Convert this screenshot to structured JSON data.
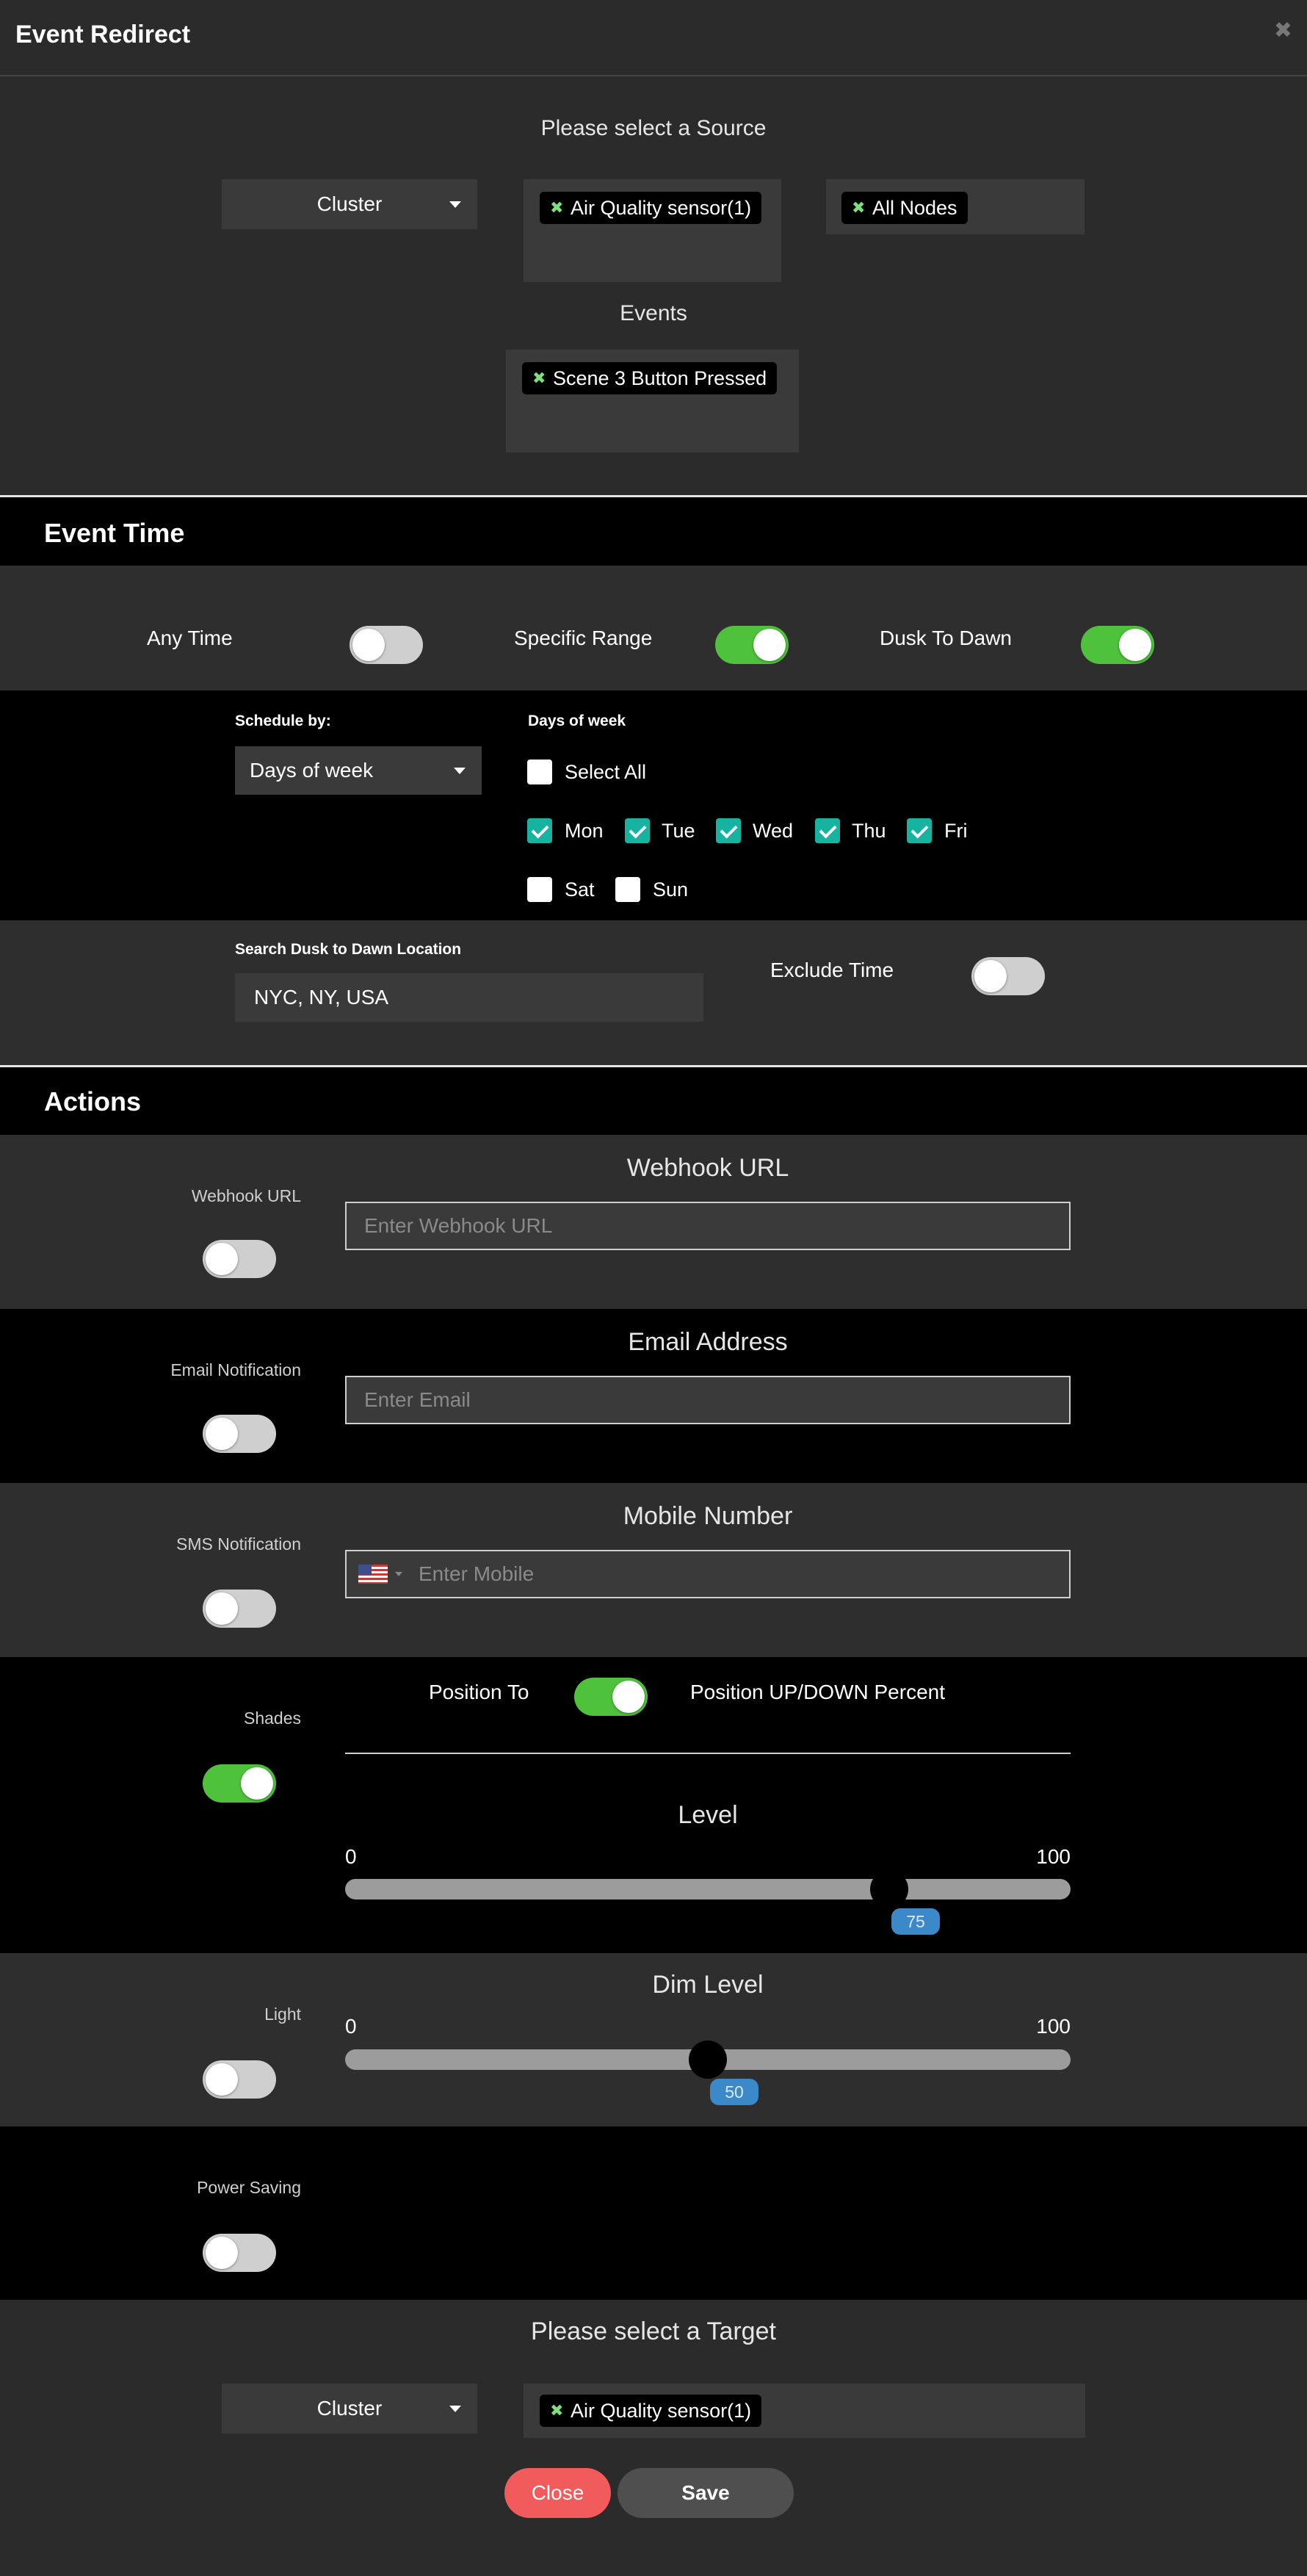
{
  "dialog": {
    "title": "Event Redirect",
    "close_icon": "close-icon"
  },
  "source": {
    "heading": "Please select a Source",
    "type_select": "Cluster",
    "selected_sources": [
      "Air Quality sensor(1)"
    ],
    "selected_nodes": [
      "All Nodes"
    ],
    "events_heading": "Events",
    "selected_events": [
      "Scene 3 Button Pressed"
    ]
  },
  "event_time": {
    "heading": "Event Time",
    "any_time": {
      "label": "Any Time",
      "on": false
    },
    "specific_range": {
      "label": "Specific Range",
      "on": true
    },
    "dusk_to_dawn": {
      "label": "Dusk To Dawn",
      "on": true
    },
    "schedule_by_label": "Schedule by:",
    "schedule_by_value": "Days of week",
    "days_label": "Days of week",
    "select_all_label": "Select All",
    "days": [
      {
        "label": "Mon",
        "checked": true
      },
      {
        "label": "Tue",
        "checked": true
      },
      {
        "label": "Wed",
        "checked": true
      },
      {
        "label": "Thu",
        "checked": true
      },
      {
        "label": "Fri",
        "checked": true
      },
      {
        "label": "Sat",
        "checked": false
      },
      {
        "label": "Sun",
        "checked": false
      }
    ],
    "location_label": "Search Dusk to Dawn Location",
    "location_value": "NYC, NY, USA",
    "exclude_time": {
      "label": "Exclude Time",
      "on": false
    }
  },
  "actions": {
    "heading": "Actions",
    "webhook": {
      "side_label": "Webhook URL",
      "title": "Webhook URL",
      "placeholder": "Enter Webhook URL",
      "on": false
    },
    "email": {
      "side_label": "Email Notification",
      "title": "Email Address",
      "placeholder": "Enter Email",
      "on": false
    },
    "sms": {
      "side_label": "SMS Notification",
      "title": "Mobile Number",
      "placeholder": "Enter Mobile",
      "country_flag": "us-flag-icon",
      "on": false
    },
    "shades": {
      "side_label": "Shades",
      "on": true,
      "position_to_label": "Position To",
      "position_toggle_on": true,
      "position_percent_label": "Position UP/DOWN Percent",
      "level_title": "Level",
      "min": "0",
      "max": "100",
      "value": 75,
      "value_label": "75"
    },
    "light": {
      "side_label": "Light",
      "on": false,
      "title": "Dim Level",
      "min": "0",
      "max": "100",
      "value": 50,
      "value_label": "50"
    },
    "power_saving": {
      "side_label": "Power Saving",
      "on": false
    }
  },
  "target": {
    "heading": "Please select a Target",
    "type_select": "Cluster",
    "selected_targets": [
      "Air Quality sensor(1)"
    ]
  },
  "buttons": {
    "close": "Close",
    "save": "Save"
  }
}
